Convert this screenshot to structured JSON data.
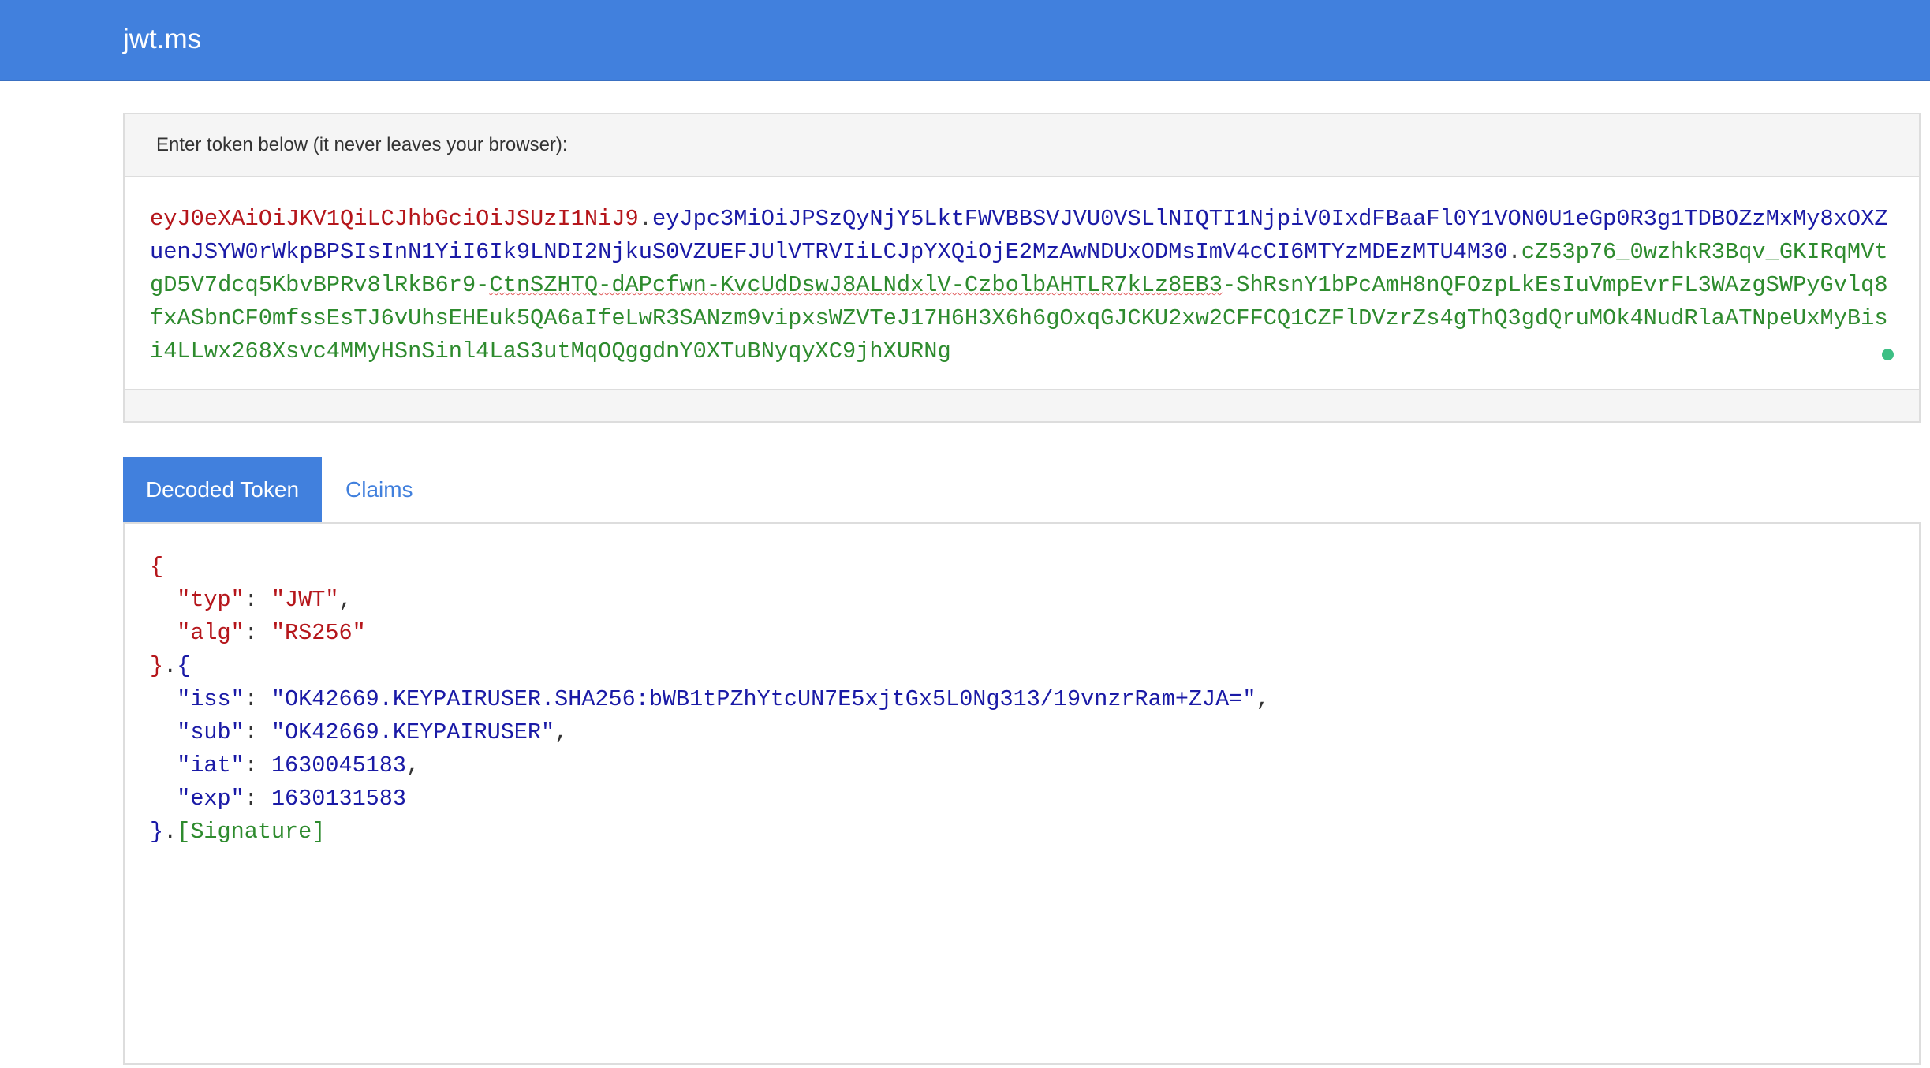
{
  "app": {
    "brand": "jwt.ms"
  },
  "token_panel": {
    "heading": "Enter token below (it never leaves your browser):",
    "token": {
      "header": "eyJ0eXAiOiJKV1QiLCJhbGciOiJSUzI1NiJ9",
      "payload": "eyJpc3MiOiJPSzQyNjY5LktFWVBBSVJVU0VSLlNIQTI1NjpiV0IxdFBaaFl0Y1VON0U1eGp0R3g1TDBOZzMxMy8xOXZuenJSYW0rWkpBPSIsInN1YiI6Ik9LNDI2NjkuS0VZUEFJUlVTRVIiLCJpYXQiOjE2MzAwNDUxODMsImV4cCI6MTYzMDEzMTU4M30",
      "signature_part1": "cZ53p76_0wzhkR3Bqv_GKIRqMVtgD5V7dcq5KbvBPRv8lRkB6r9-",
      "signature_flagged": "CtnSZHTQ-dAPcfwn-KvcUdDswJ8ALNdxlV-CzbolbAHTLR7kLz8EB3",
      "signature_part2": "-ShRsnY1bPcAmH8nQFOzpLkEsIuVmpEvrFL3WAzgSWPyGvlq8fxASbnCF0mfssEsTJ6vUhsEHEuk5QA6aIfeLwR3SANzm9vipxsWZVTeJ17H6H3X6h6gOxqGJCKU2xw2CFFCQ1CZFlDVzrZs4gThQ3gdQruMOk4NudRlaATNpeUxMyBisi4LLwx268Xsvc4MMyHSnSinl4LaS3utMqOQggdnY0XTuBNyqyXC9jhXURNg",
      "dot": "."
    },
    "status_color": "#3dbf84"
  },
  "tabs": [
    {
      "label": "Decoded Token",
      "active": true
    },
    {
      "label": "Claims",
      "active": false
    }
  ],
  "decoded": {
    "header_open": "{",
    "header_fields": [
      {
        "key": "\"typ\"",
        "value": "\"JWT\"",
        "trail": ","
      },
      {
        "key": "\"alg\"",
        "value": "\"RS256\"",
        "trail": ""
      }
    ],
    "header_close": "}",
    "join": ".",
    "payload_open": "{",
    "payload_fields": [
      {
        "key": "\"iss\"",
        "value": "\"OK42669.KEYPAIRUSER.SHA256:bWB1tPZhYtcUN7E5xjtGx5L0Ng313/19vnzrRam+ZJA=\"",
        "trail": ","
      },
      {
        "key": "\"sub\"",
        "value": "\"OK42669.KEYPAIRUSER\"",
        "trail": ","
      },
      {
        "key": "\"iat\"",
        "value": "1630045183",
        "trail": ","
      },
      {
        "key": "\"exp\"",
        "value": "1630131583",
        "trail": ""
      }
    ],
    "payload_close": "}",
    "signature": "[Signature]",
    "colon": ": "
  },
  "colors": {
    "primary": "#4180dd",
    "header_red": "#b5161b",
    "payload_blue": "#1a1aa6",
    "signature_green": "#2e8b2e"
  }
}
